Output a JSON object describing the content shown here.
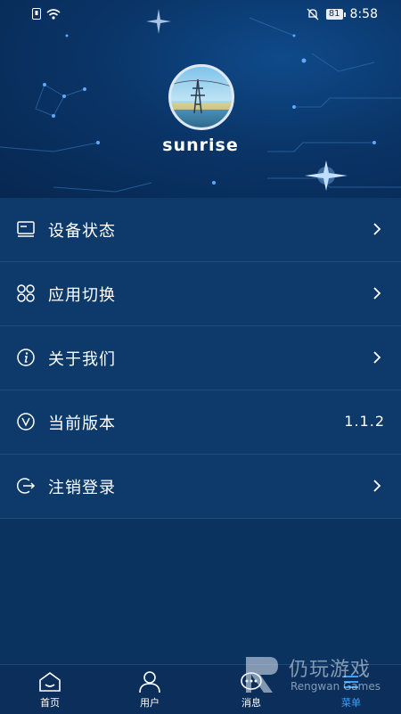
{
  "status_bar": {
    "time": "8:58",
    "battery": "81"
  },
  "profile": {
    "username": "sunrise"
  },
  "menu": [
    {
      "label": "设备状态",
      "icon": "monitor-icon",
      "value": ""
    },
    {
      "label": "应用切换",
      "icon": "apps-grid-icon",
      "value": ""
    },
    {
      "label": "关于我们",
      "icon": "info-icon",
      "value": ""
    },
    {
      "label": "当前版本",
      "icon": "version-icon",
      "value": "1.1.2"
    },
    {
      "label": "注销登录",
      "icon": "logout-icon",
      "value": ""
    }
  ],
  "tabbar": [
    {
      "label": "首页",
      "icon": "home-icon",
      "active": false
    },
    {
      "label": "用户",
      "icon": "user-icon",
      "active": false
    },
    {
      "label": "消息",
      "icon": "message-icon",
      "active": false
    },
    {
      "label": "菜单",
      "icon": "menu-icon",
      "active": true
    }
  ],
  "watermark": {
    "title": "仍玩游戏",
    "subtitle": "Rengwan Games"
  },
  "colors": {
    "background": "#0a3462",
    "accent": "#3aa0ff",
    "divider": "#1d4c7f"
  }
}
